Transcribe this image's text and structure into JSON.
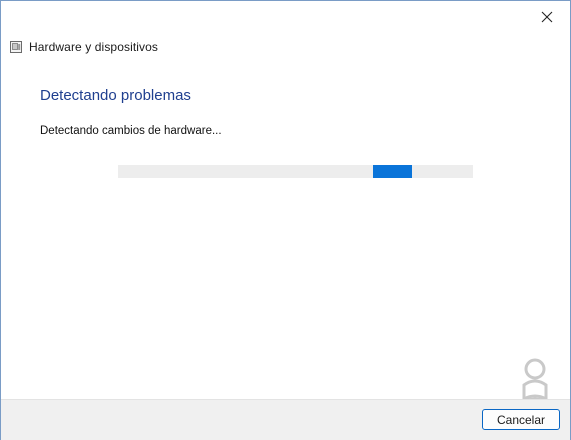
{
  "window": {
    "close_icon": "close-icon"
  },
  "header": {
    "app_icon": "hardware-devices-icon",
    "title": "Hardware y dispositivos"
  },
  "main": {
    "heading": "Detectando problemas",
    "status": "Detectando cambios de hardware...",
    "progress": {
      "style": "indeterminate",
      "color": "#0a74d9"
    }
  },
  "footer": {
    "cancel_label": "Cancelar"
  },
  "colors": {
    "heading": "#1f3f8f",
    "accent": "#0a74d9",
    "window_border": "#7a9cc6"
  }
}
